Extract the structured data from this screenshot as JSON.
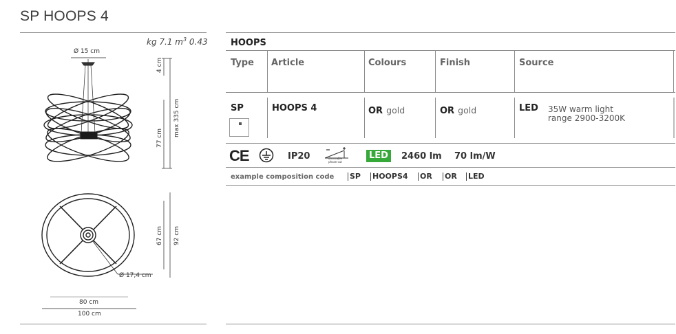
{
  "title": "SP HOOPS 4",
  "weight": {
    "kg": "kg 7.1",
    "m3_prefix": "m",
    "m3_sup": "3",
    "m3_value": " 0.43"
  },
  "dimensions": {
    "canopy_diameter": "Ø 15 cm",
    "canopy_height": "4 cm",
    "body_height": "77 cm",
    "max_height": "max 335 cm",
    "inner_height": "67 cm",
    "outer_height": "92 cm",
    "base_diameter": "Ø 17,4 cm",
    "inner_width": "80 cm",
    "outer_width": "100 cm"
  },
  "table": {
    "family": "HOOPS",
    "headers": {
      "type": "Type",
      "article": "Article",
      "colours": "Colours",
      "finish": "Finish",
      "source": "Source"
    },
    "row": {
      "type": "SP",
      "article": "HOOPS 4",
      "colour_code": "OR",
      "colour_name": "gold",
      "finish_code": "OR",
      "finish_name": "gold",
      "source_code": "LED",
      "source_line1": "35W warm light",
      "source_line2": "range 2900-3200K"
    }
  },
  "specs": {
    "ce": "CE",
    "ip": "IP20",
    "dimmable_line1": "dimmable",
    "dimmable_line2": "phase cut",
    "led_badge": "LED",
    "lumen": "2460 lm",
    "efficacy": "70 lm/W"
  },
  "composition": {
    "label": "example composition code",
    "parts": [
      "SP",
      "HOOPS4",
      "OR",
      "OR",
      "LED"
    ]
  },
  "icons": [
    "ce-mark-icon",
    "ground-icon",
    "dimmable-icon",
    "lamp-thumbnail-icon"
  ]
}
